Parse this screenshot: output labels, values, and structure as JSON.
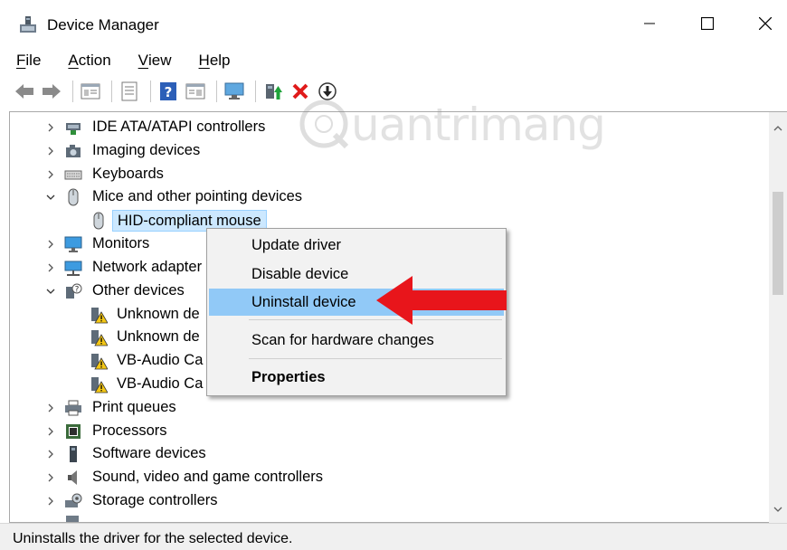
{
  "window": {
    "title": "Device Manager",
    "controls": {
      "minimize": "—",
      "maximize": "☐",
      "close": "✕"
    }
  },
  "menu": [
    {
      "key": "F",
      "rest": "ile"
    },
    {
      "key": "A",
      "rest": "ction"
    },
    {
      "key": "V",
      "rest": "iew"
    },
    {
      "key": "H",
      "rest": "elp"
    }
  ],
  "toolbar": {
    "icons": [
      "back-icon",
      "forward-icon",
      "show-hide-tree-icon",
      "properties-icon",
      "help-icon",
      "view-icon",
      "monitor-icon",
      "update-driver-icon",
      "uninstall-icon",
      "scan-hardware-icon"
    ]
  },
  "tree": {
    "items": [
      {
        "label": "IDE ATA/ATAPI controllers",
        "icon": "ide-controller-icon",
        "expanded": false
      },
      {
        "label": "Imaging devices",
        "icon": "camera-icon",
        "expanded": false
      },
      {
        "label": "Keyboards",
        "icon": "keyboard-icon",
        "expanded": false
      },
      {
        "label": "Mice and other pointing devices",
        "icon": "mouse-icon",
        "expanded": true
      },
      {
        "label": "HID-compliant mouse",
        "icon": "mouse-icon",
        "selected": true
      },
      {
        "label": "Monitors",
        "icon": "monitor-icon",
        "expanded": false
      },
      {
        "label": "Network adapter",
        "icon": "network-icon",
        "expanded": false
      },
      {
        "label": "Other devices",
        "icon": "unknown-device-icon",
        "expanded": true
      },
      {
        "label": "Unknown de",
        "icon": "warning-device-icon"
      },
      {
        "label": "Unknown de",
        "icon": "warning-device-icon"
      },
      {
        "label": "VB-Audio Ca",
        "icon": "warning-device-icon"
      },
      {
        "label": "VB-Audio Ca",
        "icon": "warning-device-icon"
      },
      {
        "label": "Print queues",
        "icon": "printer-icon",
        "expanded": false
      },
      {
        "label": "Processors",
        "icon": "processor-icon",
        "expanded": false
      },
      {
        "label": "Software devices",
        "icon": "software-device-icon",
        "expanded": false
      },
      {
        "label": "Sound, video and game controllers",
        "icon": "speaker-icon",
        "expanded": false
      },
      {
        "label": "Storage controllers",
        "icon": "storage-icon",
        "expanded": false
      }
    ]
  },
  "context_menu": {
    "items": [
      {
        "label": "Update driver"
      },
      {
        "label": "Disable device"
      },
      {
        "label": "Uninstall device",
        "highlighted": true
      },
      {
        "label": "Scan for hardware changes"
      },
      {
        "label": "Properties",
        "bold": true
      }
    ]
  },
  "status": {
    "text": "Uninstalls the driver for the selected device."
  },
  "watermark": {
    "text": "uantrimang"
  },
  "colors": {
    "selection_bg": "#cce8ff",
    "menu_highlight": "#91c9f7",
    "arrow_red": "#e8151b",
    "warning_yellow": "#f3c614"
  }
}
